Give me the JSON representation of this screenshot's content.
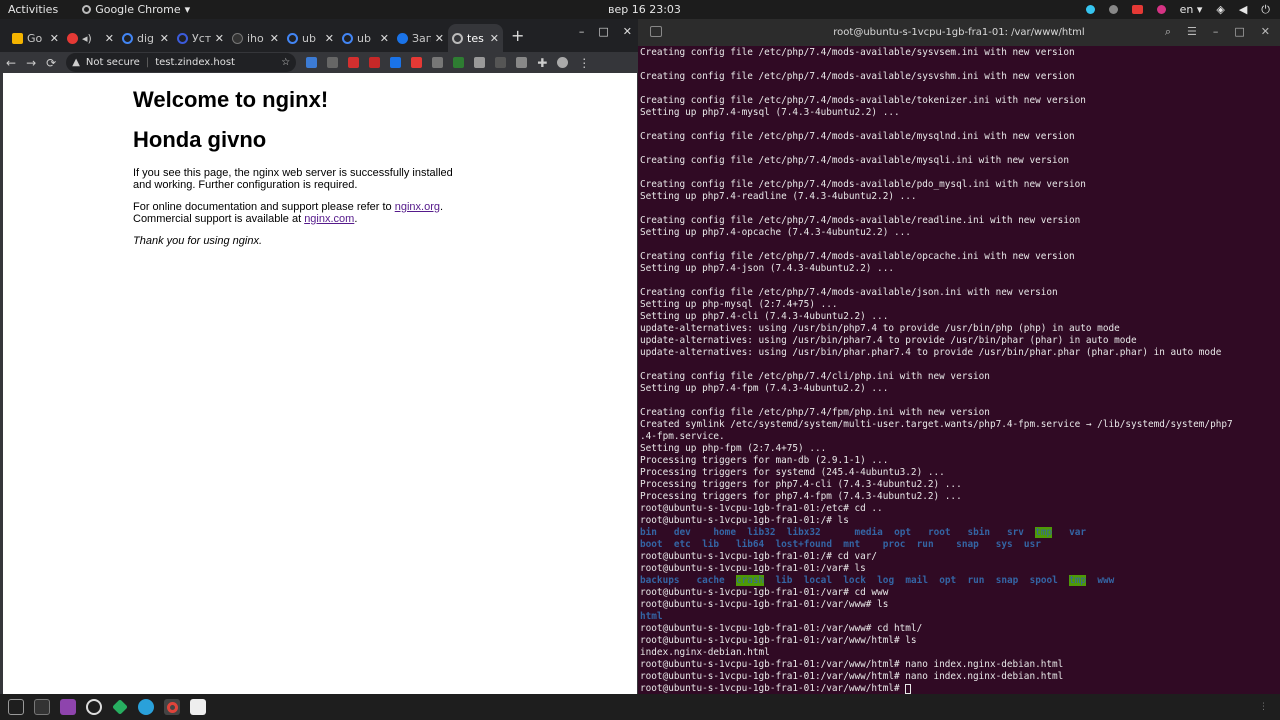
{
  "topbar": {
    "activities": "Activities",
    "app_name": "Google Chrome",
    "app_arrow": "▾",
    "clock": "вер 16  23:03",
    "lang": "en ▾",
    "tray_icons": [
      "slack-icon",
      "record-icon",
      "battery-red-icon",
      "pink-app-icon",
      "wifi-icon",
      "volume-icon",
      "power-icon"
    ]
  },
  "chrome": {
    "tabs": [
      {
        "title": "Go",
        "color": "#f4b400"
      },
      {
        "title": "",
        "color": "#e53935"
      },
      {
        "title": "dig",
        "color": "#4285f4"
      },
      {
        "title": "Уст",
        "color": "#3b5bdb"
      },
      {
        "title": "iho",
        "color": "#333333"
      },
      {
        "title": "ub",
        "color": "#4285f4"
      },
      {
        "title": "ub",
        "color": "#4285f4"
      },
      {
        "title": "Зап",
        "color": "#1a73e8"
      },
      {
        "title": "tes",
        "color": "#9e9e9e"
      }
    ],
    "new_tab": "+",
    "win_min": "–",
    "win_max": "□",
    "win_close": "✕",
    "omnibox": {
      "not_secure": "Not secure",
      "url": "test.zindex.host"
    },
    "nav": {
      "back": "←",
      "forward": "→",
      "reload": "⟳",
      "menu": "⋮"
    }
  },
  "page": {
    "heading1": "Welcome to nginx!",
    "heading2": "Honda givno",
    "para1": "If you see this page, the nginx web server is successfully installed and working. Further configuration is required.",
    "para2_pre": "For online documentation and support please refer to ",
    "link1": "nginx.org",
    "para2_mid": ".",
    "para2_line2": "Commercial support is available at ",
    "link2": "nginx.com",
    "para2_end": ".",
    "thanks": "Thank you for using nginx."
  },
  "terminal": {
    "title": "root@ubuntu-s-1vcpu-1gb-fra1-01: /var/www/html",
    "lines": [
      "Creating config file /etc/php/7.4/mods-available/sysvsem.ini with new version",
      "",
      "Creating config file /etc/php/7.4/mods-available/sysvshm.ini with new version",
      "",
      "Creating config file /etc/php/7.4/mods-available/tokenizer.ini with new version",
      "Setting up php7.4-mysql (7.4.3-4ubuntu2.2) ...",
      "",
      "Creating config file /etc/php/7.4/mods-available/mysqlnd.ini with new version",
      "",
      "Creating config file /etc/php/7.4/mods-available/mysqli.ini with new version",
      "",
      "Creating config file /etc/php/7.4/mods-available/pdo_mysql.ini with new version",
      "Setting up php7.4-readline (7.4.3-4ubuntu2.2) ...",
      "",
      "Creating config file /etc/php/7.4/mods-available/readline.ini with new version",
      "Setting up php7.4-opcache (7.4.3-4ubuntu2.2) ...",
      "",
      "Creating config file /etc/php/7.4/mods-available/opcache.ini with new version",
      "Setting up php7.4-json (7.4.3-4ubuntu2.2) ...",
      "",
      "Creating config file /etc/php/7.4/mods-available/json.ini with new version",
      "Setting up php-mysql (2:7.4+75) ...",
      "Setting up php7.4-cli (7.4.3-4ubuntu2.2) ...",
      "update-alternatives: using /usr/bin/php7.4 to provide /usr/bin/php (php) in auto mode",
      "update-alternatives: using /usr/bin/phar7.4 to provide /usr/bin/phar (phar) in auto mode",
      "update-alternatives: using /usr/bin/phar.phar7.4 to provide /usr/bin/phar.phar (phar.phar) in auto mode",
      "",
      "Creating config file /etc/php/7.4/cli/php.ini with new version",
      "Setting up php7.4-fpm (7.4.3-4ubuntu2.2) ...",
      "",
      "Creating config file /etc/php/7.4/fpm/php.ini with new version",
      "Created symlink /etc/systemd/system/multi-user.target.wants/php7.4-fpm.service → /lib/systemd/system/php7",
      ".4-fpm.service.",
      "Setting up php-fpm (2:7.4+75) ...",
      "Processing triggers for man-db (2.9.1-1) ...",
      "Processing triggers for systemd (245.4-4ubuntu3.2) ...",
      "Processing triggers for php7.4-cli (7.4.3-4ubuntu2.2) ...",
      "Processing triggers for php7.4-fpm (7.4.3-4ubuntu2.2) ...",
      "root@ubuntu-s-1vcpu-1gb-fra1-01:/etc# cd ..",
      "root@ubuntu-s-1vcpu-1gb-fra1-01:/# ls"
    ],
    "ls_root_row1": [
      "bin",
      "dev",
      "home",
      "lib32",
      "libx32",
      "media",
      "opt",
      "root",
      "sbin",
      "srv",
      "tmp",
      "var"
    ],
    "ls_root_row2": [
      "boot",
      "etc",
      "lib",
      "lib64",
      "lost+found",
      "mnt",
      "proc",
      "run",
      "snap",
      "sys",
      "usr"
    ],
    "lines2": [
      "root@ubuntu-s-1vcpu-1gb-fra1-01:/# cd var/",
      "root@ubuntu-s-1vcpu-1gb-fra1-01:/var# ls"
    ],
    "ls_var": [
      "backups",
      "cache",
      "crash",
      "lib",
      "local",
      "lock",
      "log",
      "mail",
      "opt",
      "run",
      "snap",
      "spool",
      "tmp",
      "www"
    ],
    "lines3": [
      "root@ubuntu-s-1vcpu-1gb-fra1-01:/var# cd www",
      "root@ubuntu-s-1vcpu-1gb-fra1-01:/var/www# ls"
    ],
    "ls_www": "html",
    "lines4": [
      "root@ubuntu-s-1vcpu-1gb-fra1-01:/var/www# cd html/",
      "root@ubuntu-s-1vcpu-1gb-fra1-01:/var/www/html# ls",
      "index.nginx-debian.html",
      "root@ubuntu-s-1vcpu-1gb-fra1-01:/var/www/html# nano index.nginx-debian.html",
      "root@ubuntu-s-1vcpu-1gb-fra1-01:/var/www/html# nano index.nginx-debian.html"
    ],
    "prompt": "root@ubuntu-s-1vcpu-1gb-fra1-01:/var/www/html# "
  },
  "dock": {
    "items": [
      "files-icon",
      "terminal-icon",
      "purple-app-icon",
      "chrome-icon",
      "green-app-icon",
      "telegram-icon",
      "chrome-active-icon",
      "text-editor-icon"
    ]
  }
}
